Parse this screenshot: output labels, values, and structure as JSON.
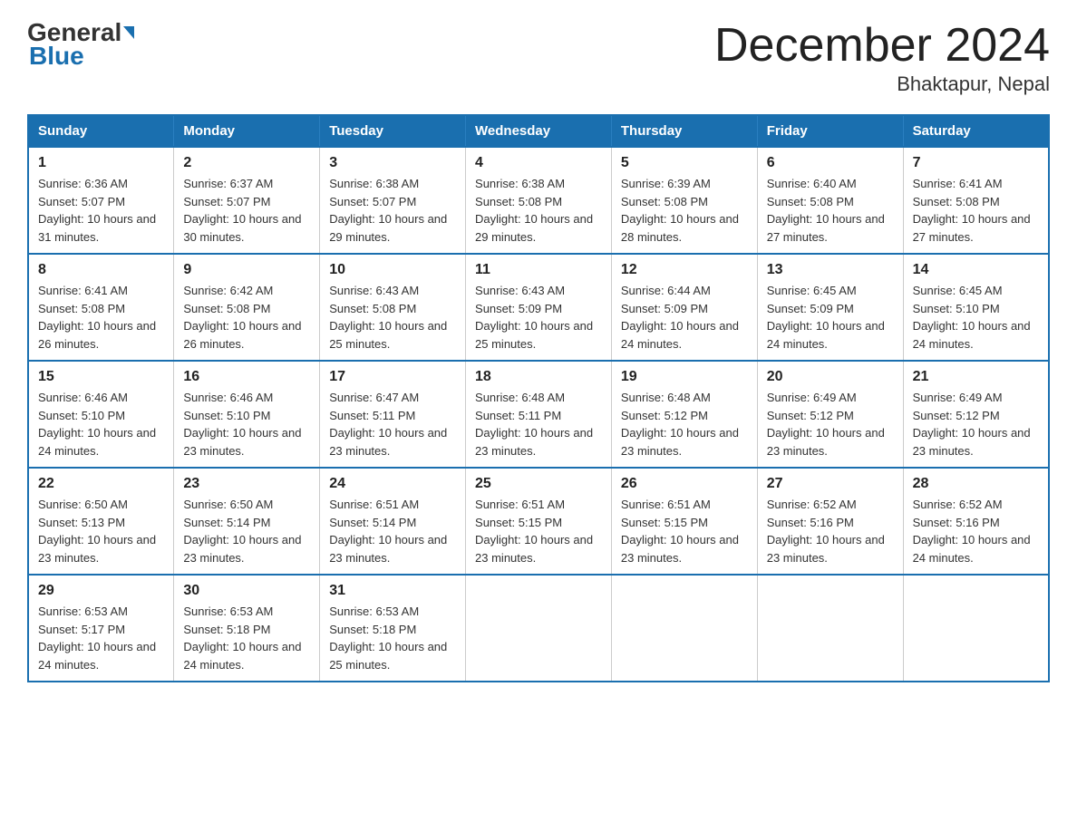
{
  "header": {
    "logo_general": "General",
    "logo_blue": "Blue",
    "month_year": "December 2024",
    "location": "Bhaktapur, Nepal"
  },
  "weekdays": [
    "Sunday",
    "Monday",
    "Tuesday",
    "Wednesday",
    "Thursday",
    "Friday",
    "Saturday"
  ],
  "weeks": [
    [
      {
        "day": "1",
        "sunrise": "6:36 AM",
        "sunset": "5:07 PM",
        "daylight": "10 hours and 31 minutes."
      },
      {
        "day": "2",
        "sunrise": "6:37 AM",
        "sunset": "5:07 PM",
        "daylight": "10 hours and 30 minutes."
      },
      {
        "day": "3",
        "sunrise": "6:38 AM",
        "sunset": "5:07 PM",
        "daylight": "10 hours and 29 minutes."
      },
      {
        "day": "4",
        "sunrise": "6:38 AM",
        "sunset": "5:08 PM",
        "daylight": "10 hours and 29 minutes."
      },
      {
        "day": "5",
        "sunrise": "6:39 AM",
        "sunset": "5:08 PM",
        "daylight": "10 hours and 28 minutes."
      },
      {
        "day": "6",
        "sunrise": "6:40 AM",
        "sunset": "5:08 PM",
        "daylight": "10 hours and 27 minutes."
      },
      {
        "day": "7",
        "sunrise": "6:41 AM",
        "sunset": "5:08 PM",
        "daylight": "10 hours and 27 minutes."
      }
    ],
    [
      {
        "day": "8",
        "sunrise": "6:41 AM",
        "sunset": "5:08 PM",
        "daylight": "10 hours and 26 minutes."
      },
      {
        "day": "9",
        "sunrise": "6:42 AM",
        "sunset": "5:08 PM",
        "daylight": "10 hours and 26 minutes."
      },
      {
        "day": "10",
        "sunrise": "6:43 AM",
        "sunset": "5:08 PM",
        "daylight": "10 hours and 25 minutes."
      },
      {
        "day": "11",
        "sunrise": "6:43 AM",
        "sunset": "5:09 PM",
        "daylight": "10 hours and 25 minutes."
      },
      {
        "day": "12",
        "sunrise": "6:44 AM",
        "sunset": "5:09 PM",
        "daylight": "10 hours and 24 minutes."
      },
      {
        "day": "13",
        "sunrise": "6:45 AM",
        "sunset": "5:09 PM",
        "daylight": "10 hours and 24 minutes."
      },
      {
        "day": "14",
        "sunrise": "6:45 AM",
        "sunset": "5:10 PM",
        "daylight": "10 hours and 24 minutes."
      }
    ],
    [
      {
        "day": "15",
        "sunrise": "6:46 AM",
        "sunset": "5:10 PM",
        "daylight": "10 hours and 24 minutes."
      },
      {
        "day": "16",
        "sunrise": "6:46 AM",
        "sunset": "5:10 PM",
        "daylight": "10 hours and 23 minutes."
      },
      {
        "day": "17",
        "sunrise": "6:47 AM",
        "sunset": "5:11 PM",
        "daylight": "10 hours and 23 minutes."
      },
      {
        "day": "18",
        "sunrise": "6:48 AM",
        "sunset": "5:11 PM",
        "daylight": "10 hours and 23 minutes."
      },
      {
        "day": "19",
        "sunrise": "6:48 AM",
        "sunset": "5:12 PM",
        "daylight": "10 hours and 23 minutes."
      },
      {
        "day": "20",
        "sunrise": "6:49 AM",
        "sunset": "5:12 PM",
        "daylight": "10 hours and 23 minutes."
      },
      {
        "day": "21",
        "sunrise": "6:49 AM",
        "sunset": "5:12 PM",
        "daylight": "10 hours and 23 minutes."
      }
    ],
    [
      {
        "day": "22",
        "sunrise": "6:50 AM",
        "sunset": "5:13 PM",
        "daylight": "10 hours and 23 minutes."
      },
      {
        "day": "23",
        "sunrise": "6:50 AM",
        "sunset": "5:14 PM",
        "daylight": "10 hours and 23 minutes."
      },
      {
        "day": "24",
        "sunrise": "6:51 AM",
        "sunset": "5:14 PM",
        "daylight": "10 hours and 23 minutes."
      },
      {
        "day": "25",
        "sunrise": "6:51 AM",
        "sunset": "5:15 PM",
        "daylight": "10 hours and 23 minutes."
      },
      {
        "day": "26",
        "sunrise": "6:51 AM",
        "sunset": "5:15 PM",
        "daylight": "10 hours and 23 minutes."
      },
      {
        "day": "27",
        "sunrise": "6:52 AM",
        "sunset": "5:16 PM",
        "daylight": "10 hours and 23 minutes."
      },
      {
        "day": "28",
        "sunrise": "6:52 AM",
        "sunset": "5:16 PM",
        "daylight": "10 hours and 24 minutes."
      }
    ],
    [
      {
        "day": "29",
        "sunrise": "6:53 AM",
        "sunset": "5:17 PM",
        "daylight": "10 hours and 24 minutes."
      },
      {
        "day": "30",
        "sunrise": "6:53 AM",
        "sunset": "5:18 PM",
        "daylight": "10 hours and 24 minutes."
      },
      {
        "day": "31",
        "sunrise": "6:53 AM",
        "sunset": "5:18 PM",
        "daylight": "10 hours and 25 minutes."
      },
      null,
      null,
      null,
      null
    ]
  ]
}
